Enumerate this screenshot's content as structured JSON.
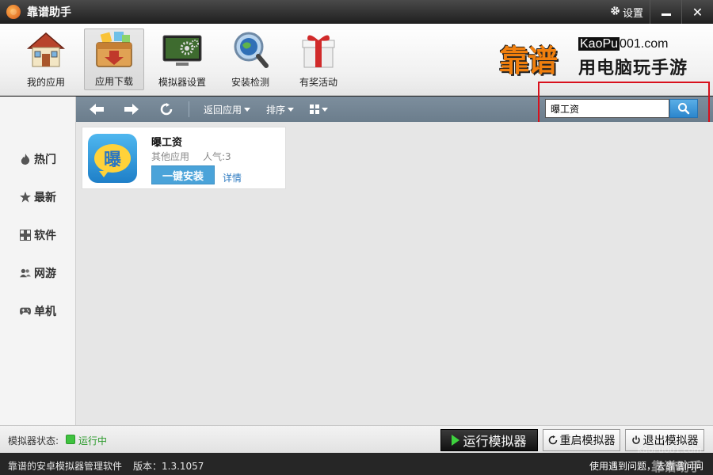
{
  "window": {
    "title": "靠谱助手",
    "settings_label": "设置",
    "minimize": "—",
    "close": "✕"
  },
  "toolbar": {
    "items": [
      {
        "label": "我的应用",
        "icon": "house-icon"
      },
      {
        "label": "应用下载",
        "icon": "download-box-icon",
        "active": true
      },
      {
        "label": "模拟器设置",
        "icon": "monitor-gears-icon"
      },
      {
        "label": "安装检测",
        "icon": "magnifier-globe-icon"
      },
      {
        "label": "有奖活动",
        "icon": "gift-box-icon"
      }
    ]
  },
  "brand": {
    "logo_text": "靠谱",
    "url_prefix": "KaoPu",
    "url_suffix": "001.com",
    "slogan": "用电脑玩手游"
  },
  "sidebar": {
    "items": [
      {
        "label": "热门",
        "icon": "flame-icon"
      },
      {
        "label": "最新",
        "icon": "star-icon"
      },
      {
        "label": "软件",
        "icon": "grid-icon"
      },
      {
        "label": "网游",
        "icon": "users-icon"
      },
      {
        "label": "单机",
        "icon": "gamepad-icon"
      }
    ]
  },
  "navbar": {
    "back_label": "返回应用",
    "sort_label": "排序",
    "icons": [
      "arrow-left-icon",
      "arrow-right-icon",
      "refresh-icon",
      "view-grid-icon"
    ]
  },
  "search": {
    "value": "曝工资",
    "placeholder": ""
  },
  "results": [
    {
      "name": "曝工资",
      "category": "其他应用",
      "popularity": "人气:3",
      "icon_char": "曝",
      "install_label": "一键安装",
      "detail_label": "详情"
    }
  ],
  "status": {
    "label": "模拟器状态:",
    "value": "运行中",
    "run_label": "运行模拟器",
    "restart_label": "重启模拟器",
    "exit_label": "退出模拟器"
  },
  "footer": {
    "app_desc": "靠谱的安卓模拟器管理软件",
    "version": "版本：1.3.1057",
    "help_text": "使用遇到问题，去靠谱问问"
  },
  "watermark": {
    "url": "KaoPu001.com",
    "text": "靠谱助手"
  },
  "colors": {
    "accent_orange": "#f07f0e",
    "nav_bar": "#71838f",
    "install_button": "#4aa3d9",
    "running_green": "#3fc23f",
    "highlight_red": "#d8101c"
  }
}
